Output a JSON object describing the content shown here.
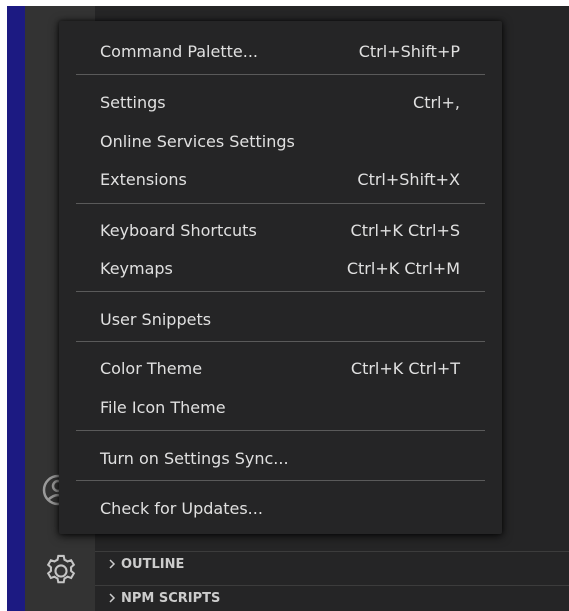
{
  "menu": {
    "items": [
      {
        "label": "Command Palette...",
        "shortcut": "Ctrl+Shift+P"
      },
      {
        "label": "Settings",
        "shortcut": "Ctrl+,"
      },
      {
        "label": "Online Services Settings",
        "shortcut": ""
      },
      {
        "label": "Extensions",
        "shortcut": "Ctrl+Shift+X"
      },
      {
        "label": "Keyboard Shortcuts",
        "shortcut": "Ctrl+K Ctrl+S"
      },
      {
        "label": "Keymaps",
        "shortcut": "Ctrl+K Ctrl+M"
      },
      {
        "label": "User Snippets",
        "shortcut": ""
      },
      {
        "label": "Color Theme",
        "shortcut": "Ctrl+K Ctrl+T"
      },
      {
        "label": "File Icon Theme",
        "shortcut": ""
      },
      {
        "label": "Turn on Settings Sync...",
        "shortcut": ""
      },
      {
        "label": "Check for Updates...",
        "shortcut": ""
      }
    ]
  },
  "panels": {
    "outline": "OUTLINE",
    "npm_scripts": "NPM SCRIPTS"
  },
  "icons": {
    "accounts": "accounts-icon",
    "manage": "gear-icon",
    "chevron": "chevron-right-icon"
  },
  "colors": {
    "accent_strip": "#1c1a82",
    "activity_bar": "#333333",
    "menu_bg": "#252526",
    "text": "#e0e0e0"
  }
}
